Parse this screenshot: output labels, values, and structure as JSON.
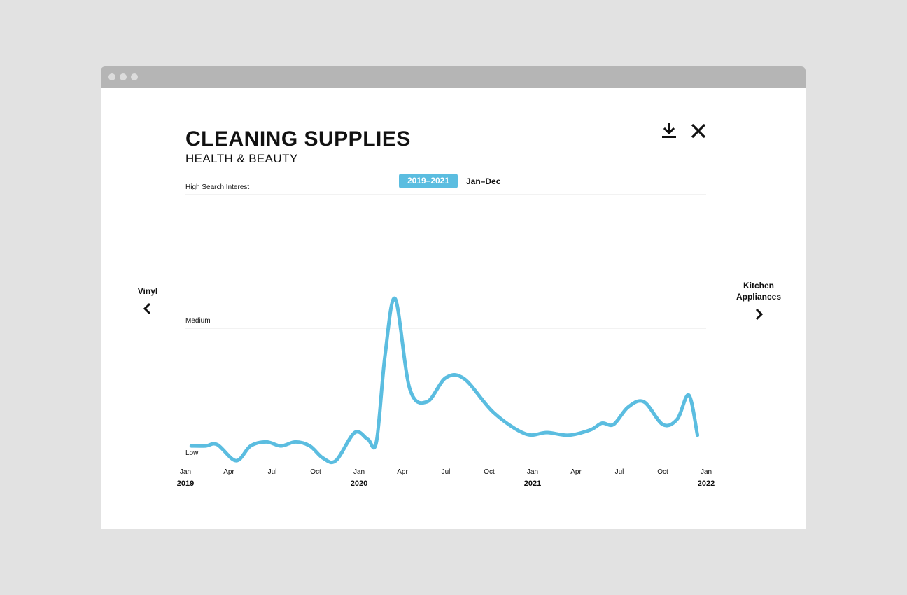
{
  "window": {
    "titlebar_dots": 3
  },
  "header": {
    "title": "CLEANING SUPPLIES",
    "subtitle": "HEALTH & BEAUTY",
    "download_icon": "download-icon",
    "close_icon": "close-icon"
  },
  "filters": {
    "period": "2019–2021",
    "range": "Jan–Dec"
  },
  "navigation": {
    "prev_label": "Vinyl",
    "next_label": "Kitchen Appliances",
    "prev_icon": "chevron-left-icon",
    "next_icon": "chevron-right-icon"
  },
  "colors": {
    "accent": "#5bbde0",
    "gridline": "#e4e4e4",
    "text": "#111111"
  },
  "chart_data": {
    "type": "line",
    "title": "CLEANING SUPPLIES",
    "subtitle": "HEALTH & BEAUTY",
    "y_levels": [
      {
        "label": "Low",
        "value": 0
      },
      {
        "label": "Medium",
        "value": 1
      },
      {
        "label": "High Search Interest",
        "value": 2
      }
    ],
    "ylim": [
      0,
      2
    ],
    "x_ticks": [
      {
        "month": "Jan",
        "year": "2019",
        "t": 0
      },
      {
        "month": "Apr",
        "t": 3
      },
      {
        "month": "Jul",
        "t": 6
      },
      {
        "month": "Oct",
        "t": 9
      },
      {
        "month": "Jan",
        "year": "2020",
        "t": 12
      },
      {
        "month": "Apr",
        "t": 15
      },
      {
        "month": "Jul",
        "t": 18
      },
      {
        "month": "Oct",
        "t": 21
      },
      {
        "month": "Jan",
        "year": "2021",
        "t": 24
      },
      {
        "month": "Apr",
        "t": 27
      },
      {
        "month": "Jul",
        "t": 30
      },
      {
        "month": "Oct",
        "t": 33
      },
      {
        "month": "Jan",
        "year": "2022",
        "t": 36
      }
    ],
    "series": [
      {
        "color": "#5bbde0",
        "points": [
          [
            0.4,
            0.12
          ],
          [
            1.4,
            0.12
          ],
          [
            2.2,
            0.13
          ],
          [
            3.5,
            0.01
          ],
          [
            4.5,
            0.12
          ],
          [
            5.6,
            0.15
          ],
          [
            6.6,
            0.12
          ],
          [
            7.6,
            0.15
          ],
          [
            8.6,
            0.12
          ],
          [
            9.5,
            0.03
          ],
          [
            10.4,
            0.01
          ],
          [
            11.7,
            0.22
          ],
          [
            12.6,
            0.17
          ],
          [
            13.2,
            0.15
          ],
          [
            13.8,
            0.8
          ],
          [
            14.5,
            1.22
          ],
          [
            15.5,
            0.55
          ],
          [
            16.7,
            0.45
          ],
          [
            18.0,
            0.63
          ],
          [
            19.3,
            0.62
          ],
          [
            21.3,
            0.37
          ],
          [
            23.5,
            0.21
          ],
          [
            25.0,
            0.22
          ],
          [
            26.5,
            0.2
          ],
          [
            28.0,
            0.24
          ],
          [
            28.8,
            0.29
          ],
          [
            29.6,
            0.28
          ],
          [
            30.6,
            0.41
          ],
          [
            31.7,
            0.45
          ],
          [
            33.0,
            0.28
          ],
          [
            34.0,
            0.32
          ],
          [
            34.8,
            0.5
          ],
          [
            35.4,
            0.2
          ]
        ]
      }
    ]
  }
}
